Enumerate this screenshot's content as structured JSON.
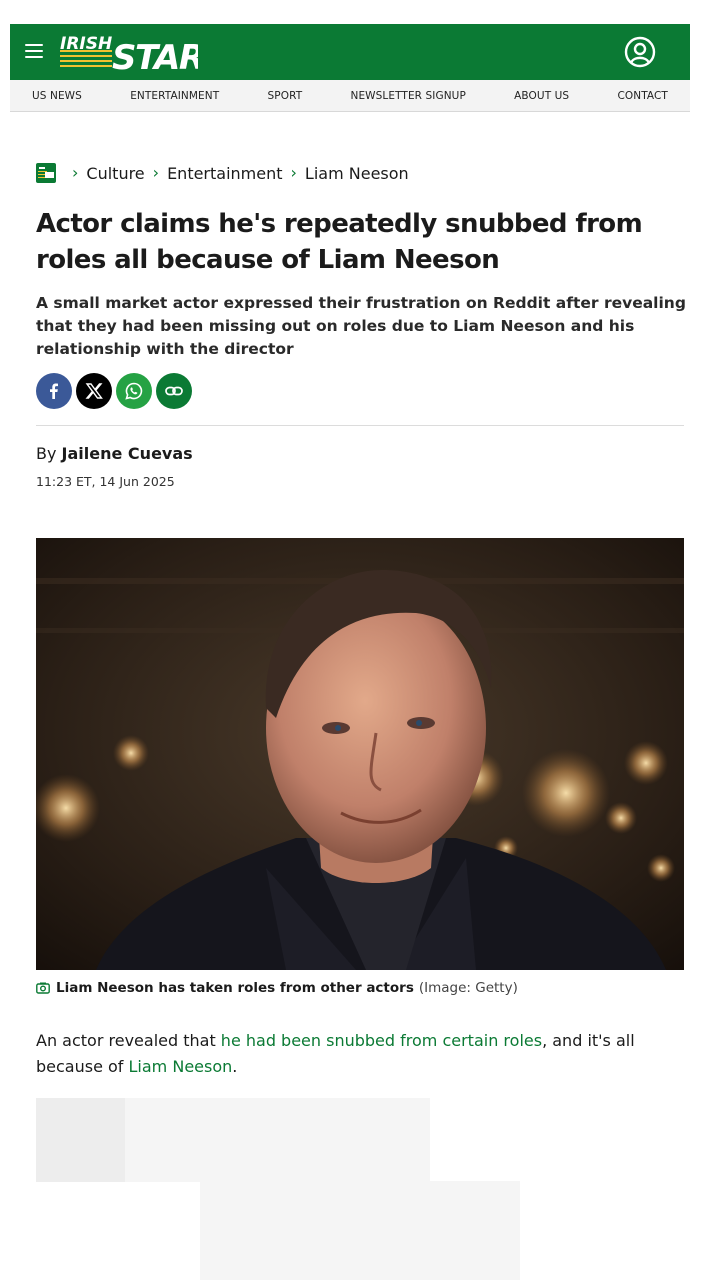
{
  "header": {
    "logo_text_1": "IRISH",
    "logo_text_2": "STAR",
    "brand_color": "#0b7a34",
    "menu_icon": "hamburger-icon",
    "account_icon": "user-circle-icon"
  },
  "nav": {
    "items": [
      {
        "label": "US NEWS"
      },
      {
        "label": "ENTERTAINMENT"
      },
      {
        "label": "SPORT"
      },
      {
        "label": "NEWSLETTER SIGNUP"
      },
      {
        "label": "ABOUT US"
      },
      {
        "label": "CONTACT"
      }
    ]
  },
  "breadcrumb": {
    "items": [
      {
        "label": "Culture"
      },
      {
        "label": "Entertainment"
      },
      {
        "label": "Liam Neeson"
      }
    ]
  },
  "article": {
    "title": "Actor claims he's repeatedly snubbed from roles all because of Liam Neeson",
    "standfirst": "A small market actor expressed their frustration on Reddit after revealing that they had been missing out on roles due to Liam Neeson and his relationship with the director",
    "share": [
      {
        "name": "facebook",
        "icon": "facebook-icon",
        "color": "#3b5998"
      },
      {
        "name": "x",
        "icon": "x-icon",
        "color": "#000000"
      },
      {
        "name": "whatsapp",
        "icon": "whatsapp-icon",
        "color": "#25a244"
      },
      {
        "name": "copy-link",
        "icon": "link-icon",
        "color": "#0b7a34"
      }
    ],
    "byline_prefix": "By",
    "author": "Jailene Cuevas",
    "date": "11:23 ET, 14 Jun 2025",
    "image_caption": "Liam Neeson has taken roles from other actors",
    "image_credit": "(Image: Getty)",
    "caption_icon": "camera-icon",
    "body": {
      "p1_start": "An actor revealed that ",
      "p1_link1": "he had been snubbed from certain roles",
      "p1_mid": ", and it's all because of ",
      "p1_link2": "Liam Neeson",
      "p1_end": "."
    }
  }
}
